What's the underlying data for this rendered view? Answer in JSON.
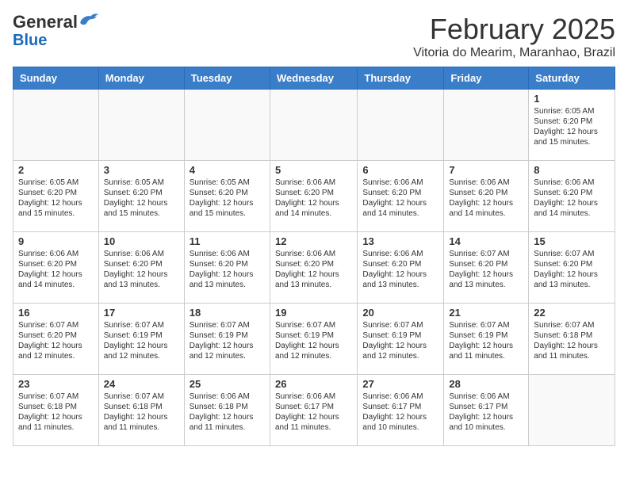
{
  "header": {
    "logo_general": "General",
    "logo_blue": "Blue",
    "month": "February 2025",
    "location": "Vitoria do Mearim, Maranhao, Brazil"
  },
  "days_of_week": [
    "Sunday",
    "Monday",
    "Tuesday",
    "Wednesday",
    "Thursday",
    "Friday",
    "Saturday"
  ],
  "weeks": [
    [
      {
        "day": "",
        "info": ""
      },
      {
        "day": "",
        "info": ""
      },
      {
        "day": "",
        "info": ""
      },
      {
        "day": "",
        "info": ""
      },
      {
        "day": "",
        "info": ""
      },
      {
        "day": "",
        "info": ""
      },
      {
        "day": "1",
        "info": "Sunrise: 6:05 AM\nSunset: 6:20 PM\nDaylight: 12 hours and 15 minutes."
      }
    ],
    [
      {
        "day": "2",
        "info": "Sunrise: 6:05 AM\nSunset: 6:20 PM\nDaylight: 12 hours and 15 minutes."
      },
      {
        "day": "3",
        "info": "Sunrise: 6:05 AM\nSunset: 6:20 PM\nDaylight: 12 hours and 15 minutes."
      },
      {
        "day": "4",
        "info": "Sunrise: 6:05 AM\nSunset: 6:20 PM\nDaylight: 12 hours and 15 minutes."
      },
      {
        "day": "5",
        "info": "Sunrise: 6:06 AM\nSunset: 6:20 PM\nDaylight: 12 hours and 14 minutes."
      },
      {
        "day": "6",
        "info": "Sunrise: 6:06 AM\nSunset: 6:20 PM\nDaylight: 12 hours and 14 minutes."
      },
      {
        "day": "7",
        "info": "Sunrise: 6:06 AM\nSunset: 6:20 PM\nDaylight: 12 hours and 14 minutes."
      },
      {
        "day": "8",
        "info": "Sunrise: 6:06 AM\nSunset: 6:20 PM\nDaylight: 12 hours and 14 minutes."
      }
    ],
    [
      {
        "day": "9",
        "info": "Sunrise: 6:06 AM\nSunset: 6:20 PM\nDaylight: 12 hours and 14 minutes."
      },
      {
        "day": "10",
        "info": "Sunrise: 6:06 AM\nSunset: 6:20 PM\nDaylight: 12 hours and 13 minutes."
      },
      {
        "day": "11",
        "info": "Sunrise: 6:06 AM\nSunset: 6:20 PM\nDaylight: 12 hours and 13 minutes."
      },
      {
        "day": "12",
        "info": "Sunrise: 6:06 AM\nSunset: 6:20 PM\nDaylight: 12 hours and 13 minutes."
      },
      {
        "day": "13",
        "info": "Sunrise: 6:06 AM\nSunset: 6:20 PM\nDaylight: 12 hours and 13 minutes."
      },
      {
        "day": "14",
        "info": "Sunrise: 6:07 AM\nSunset: 6:20 PM\nDaylight: 12 hours and 13 minutes."
      },
      {
        "day": "15",
        "info": "Sunrise: 6:07 AM\nSunset: 6:20 PM\nDaylight: 12 hours and 13 minutes."
      }
    ],
    [
      {
        "day": "16",
        "info": "Sunrise: 6:07 AM\nSunset: 6:20 PM\nDaylight: 12 hours and 12 minutes."
      },
      {
        "day": "17",
        "info": "Sunrise: 6:07 AM\nSunset: 6:19 PM\nDaylight: 12 hours and 12 minutes."
      },
      {
        "day": "18",
        "info": "Sunrise: 6:07 AM\nSunset: 6:19 PM\nDaylight: 12 hours and 12 minutes."
      },
      {
        "day": "19",
        "info": "Sunrise: 6:07 AM\nSunset: 6:19 PM\nDaylight: 12 hours and 12 minutes."
      },
      {
        "day": "20",
        "info": "Sunrise: 6:07 AM\nSunset: 6:19 PM\nDaylight: 12 hours and 12 minutes."
      },
      {
        "day": "21",
        "info": "Sunrise: 6:07 AM\nSunset: 6:19 PM\nDaylight: 12 hours and 11 minutes."
      },
      {
        "day": "22",
        "info": "Sunrise: 6:07 AM\nSunset: 6:18 PM\nDaylight: 12 hours and 11 minutes."
      }
    ],
    [
      {
        "day": "23",
        "info": "Sunrise: 6:07 AM\nSunset: 6:18 PM\nDaylight: 12 hours and 11 minutes."
      },
      {
        "day": "24",
        "info": "Sunrise: 6:07 AM\nSunset: 6:18 PM\nDaylight: 12 hours and 11 minutes."
      },
      {
        "day": "25",
        "info": "Sunrise: 6:06 AM\nSunset: 6:18 PM\nDaylight: 12 hours and 11 minutes."
      },
      {
        "day": "26",
        "info": "Sunrise: 6:06 AM\nSunset: 6:17 PM\nDaylight: 12 hours and 11 minutes."
      },
      {
        "day": "27",
        "info": "Sunrise: 6:06 AM\nSunset: 6:17 PM\nDaylight: 12 hours and 10 minutes."
      },
      {
        "day": "28",
        "info": "Sunrise: 6:06 AM\nSunset: 6:17 PM\nDaylight: 12 hours and 10 minutes."
      },
      {
        "day": "",
        "info": ""
      }
    ]
  ]
}
